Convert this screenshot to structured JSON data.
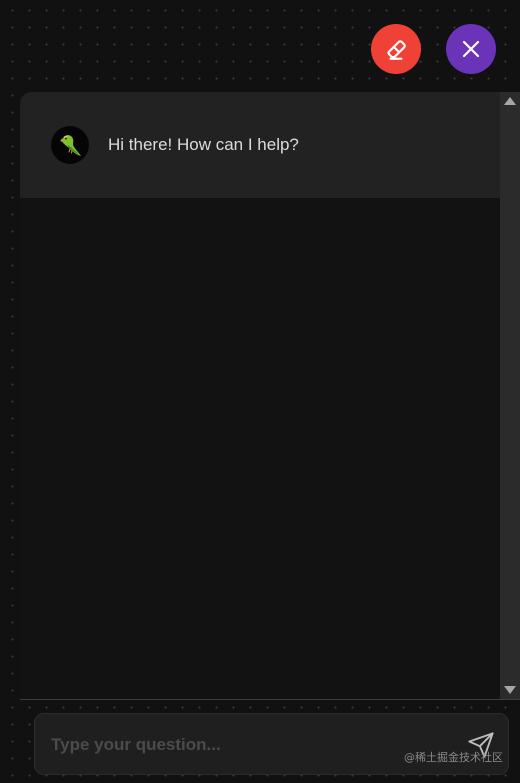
{
  "header_actions": {
    "clear_icon": "eraser-icon",
    "close_icon": "close-icon",
    "clear_color": "#ef4136",
    "close_color": "#6a33b8"
  },
  "messages": [
    {
      "sender": "bot",
      "avatar_icon": "parrot-icon",
      "text": "Hi there! How can I help?"
    }
  ],
  "input": {
    "placeholder": "Type your question...",
    "value": "",
    "send_icon": "send-icon"
  },
  "watermark": "@稀土掘金技术社区"
}
